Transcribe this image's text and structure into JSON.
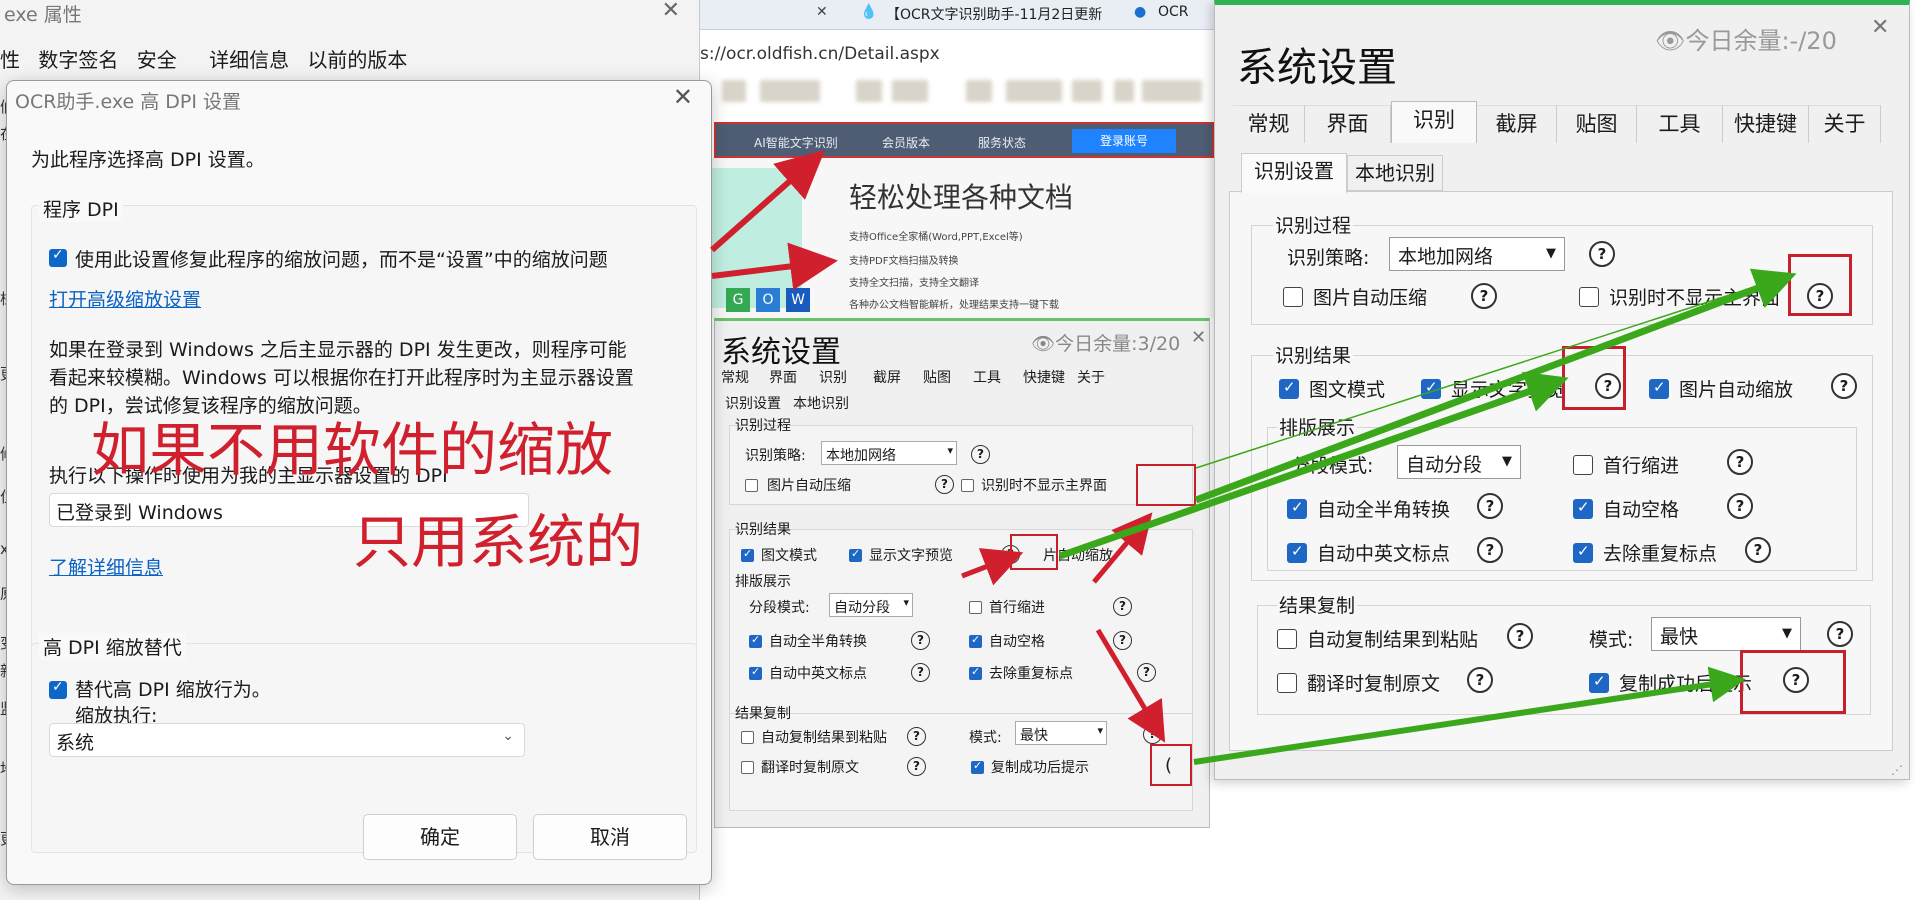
{
  "props_window": {
    "title": "exe 属性",
    "tabs": [
      "性",
      "数字签名",
      "安全",
      "详细信息",
      "以前的版本"
    ],
    "edge_letters": [
      "们",
      "在",
      "梯",
      "更",
      "修",
      "位",
      "x",
      "原",
      "变",
      "新",
      "监",
      "地",
      "更"
    ]
  },
  "browser": {
    "tabs": [
      "【OCR文字识别助手-11月2日更新",
      "OCR"
    ],
    "address": "s://ocr.oldfish.cn/Detail.aspx",
    "nav": [
      "AI智能文字识别",
      "会员版本",
      "服务状态"
    ],
    "login": "登录账号",
    "headline": "轻松处理各种文档",
    "lines": [
      "支持Office全家桶(Word,PPT,Excel等)",
      "支持PDF文档扫描及转换",
      "支持全文扫描，支持全文翻译",
      "各种办公文档智能解析，处理结果支持一键下载"
    ],
    "icons": [
      "G",
      "O",
      "W"
    ]
  },
  "small_settings": {
    "title": "系统设置",
    "quota": "今日余量:3/20",
    "close": "✕",
    "tabs": [
      "常规",
      "界面",
      "识别",
      "截屏",
      "贴图",
      "工具",
      "快捷键",
      "关于"
    ],
    "subtabs": [
      "识别设置",
      "本地识别"
    ],
    "process_title": "识别过程",
    "strategy_label": "识别策略:",
    "strategy_value": "本地加网络",
    "auto_compress": "图片自动压缩",
    "hide_main": "识别时不显示主界面",
    "result_title": "识别结果",
    "image_text_mode": "图文模式",
    "show_preview": "显示文字预览",
    "auto_zoom": "片自动缩放",
    "layout_title": "排版展示",
    "segment_label": "分段模式:",
    "segment_value": "自动分段",
    "first_indent": "首行缩进",
    "fullhalf": "自动全半角转换",
    "auto_space": "自动空格",
    "cn_en_punct": "自动中英文标点",
    "dedupe_punct": "去除重复标点",
    "copy_title": "结果复制",
    "auto_copy": "自动复制结果到粘贴",
    "mode_label": "模式:",
    "mode_value": "最快",
    "copy_original": "翻译时复制原文",
    "copy_tip": "复制成功后提示",
    "q": "?",
    "partial": "("
  },
  "dpi_dialog": {
    "title": "OCR助手.exe 高 DPI 设置",
    "close": "✕",
    "intro": "为此程序选择高 DPI 设置。",
    "program_dpi": "程序 DPI",
    "use_setting": "使用此设置修复此程序的缩放问题，而不是“设置”中的缩放问题",
    "open_advanced": "打开高级缩放设置",
    "para_line1": "如果在登录到 Windows 之后主显示器的 DPI 发生更改，则程序可能",
    "para_line2": "看起来较模糊。Windows 可以根据你在打开此程序时为主显示器设置",
    "para_line3": "的 DPI，尝试修复该程序的缩放问题。",
    "use_dpi_label": "执行以下操作时使用为我的主显示器设置的 DPI",
    "logon_value": "已登录到 Windows",
    "learn_more": "了解详细信息",
    "override_title": "高 DPI 缩放替代",
    "override_check": "替代高 DPI 缩放行为。",
    "scaling_by": "缩放执行:",
    "scaling_value": "系统",
    "ok": "确定",
    "cancel": "取消",
    "annotation_line1": "如果不用软件的缩放",
    "annotation_line2": "只用系统的"
  },
  "big_settings": {
    "title": "系统设置",
    "quota": "今日余量:-/20",
    "close": "✕",
    "tabs": [
      "常规",
      "界面",
      "识别",
      "截屏",
      "贴图",
      "工具",
      "快捷键",
      "关于"
    ],
    "subtabs": [
      "识别设置",
      "本地识别"
    ],
    "process_title": "识别过程",
    "strategy_label": "识别策略:",
    "strategy_value": "本地加网络",
    "auto_compress": "图片自动压缩",
    "hide_main": "识别时不显示主界面",
    "result_title": "识别结果",
    "image_text_mode": "图文模式",
    "show_preview": "显示文字预览",
    "auto_zoom": "图片自动缩放",
    "layout_title": "排版展示",
    "segment_label": "分段模式:",
    "segment_value": "自动分段",
    "first_indent": "首行缩进",
    "fullhalf": "自动全半角转换",
    "auto_space": "自动空格",
    "cn_en_punct": "自动中英文标点",
    "dedupe_punct": "去除重复标点",
    "copy_title": "结果复制",
    "auto_copy": "自动复制结果到粘贴",
    "mode_label": "模式:",
    "mode_value": "最快",
    "copy_original": "翻译时复制原文",
    "copy_tip": "复制成功后提示",
    "q": "?"
  },
  "colors": {
    "annotation_red": "#d0202e",
    "arrow_green": "#3aa81a",
    "checkbox_blue": "#1e67c5",
    "title_green": "#2fb352"
  }
}
